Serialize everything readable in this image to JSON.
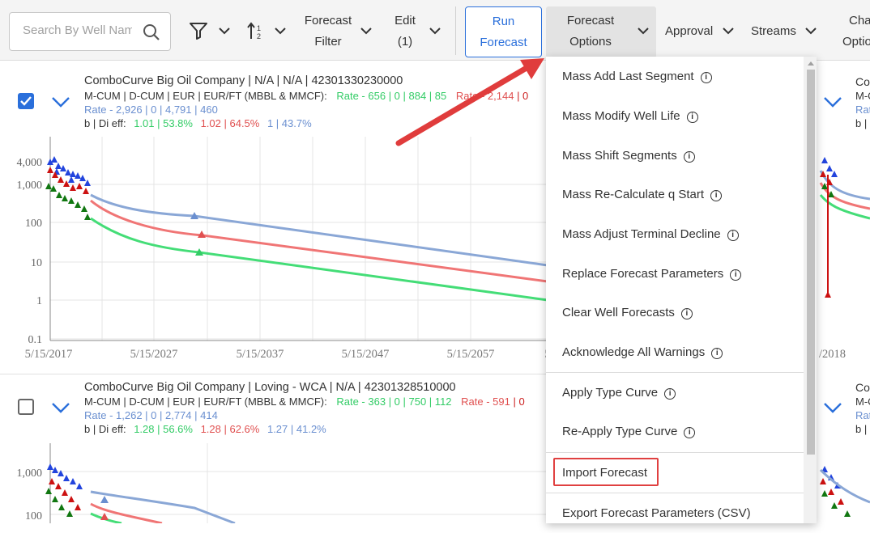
{
  "toolbar": {
    "search_placeholder": "Search By Well Name",
    "forecast_filter_line1": "Forecast",
    "forecast_filter_line2": "Filter",
    "edit_line1": "Edit",
    "edit_line2": "(1)",
    "run_line1": "Run",
    "run_line2": "Forecast",
    "options_line1": "Forecast",
    "options_line2": "Options",
    "approval": "Approval",
    "streams": "Streams",
    "chart_options_line1": "Cha",
    "chart_options_line2": "Optio"
  },
  "cards": [
    {
      "title": "ComboCurve Big Oil Company | N/A | N/A | 42301330230000",
      "line2_prefix": "M-CUM | D-CUM | EUR | EUR/FT (MBBL & MMCF):",
      "line2_rate_green": "Rate - 656",
      "line2_rest_green": "| 0 | 884 | 85",
      "line2_rate_red": "Rate - 2,144",
      "line2_rest_red": "| 0",
      "line3_blue": "Rate - 2,926 | 0 | 4,791 | 460",
      "line4_prefix": "b | Di eff:",
      "line4_green": "1.01 | 53.8%",
      "line4_red": "1.02 | 64.5%",
      "line4_blue": "1 | 43.7%",
      "checked": true,
      "y_ticks": [
        "4,000",
        "1,000",
        "100",
        "10",
        "1",
        "0.1"
      ],
      "x_ticks": [
        "5/15/2017",
        "5/15/2027",
        "5/15/2037",
        "5/15/2047",
        "5/15/2057",
        "5"
      ]
    },
    {
      "title": "ComboCurve Big Oil Company | Loving - WCA | N/A | 42301328510000",
      "line2_prefix": "M-CUM | D-CUM | EUR | EUR/FT (MBBL & MMCF):",
      "line2_rate_green": "Rate - 363",
      "line2_rest_green": "| 0 | 750 | 112",
      "line2_rate_red": "Rate - 591",
      "line2_rest_red": "| 0",
      "line3_blue": "Rate - 1,262 | 0 | 2,774 | 414",
      "line4_prefix": "b | Di eff:",
      "line4_green": "1.28 | 56.6%",
      "line4_red": "1.28 | 62.6%",
      "line4_blue": "1.27 | 41.2%",
      "checked": false,
      "y_ticks": [
        "1,000",
        "100"
      ]
    }
  ],
  "right_cards": [
    {
      "line1": "Co",
      "line2": "M-C",
      "line3": "Rat",
      "line4": "b |",
      "x_tick": "/2018"
    },
    {
      "line1": "Co",
      "line2": "M-C",
      "line3": "Rat",
      "line4": "b |"
    }
  ],
  "menu": {
    "items": [
      "Mass Add Last Segment",
      "Mass Modify Well Life",
      "Mass Shift Segments",
      "Mass Re-Calculate q Start",
      "Mass Adjust Terminal Decline",
      "Replace Forecast Parameters",
      "Clear Well Forecasts",
      "Acknowledge All Warnings",
      "Apply Type Curve",
      "Re-Apply Type Curve",
      "Import Forecast",
      "Export Forecast Parameters (CSV)"
    ],
    "info_glyph": "i"
  },
  "colors": {
    "accent": "#2a6fdb",
    "oil": "#33cc66",
    "gas": "#e05050",
    "water": "#6a8fd0",
    "highlight": "#e04040"
  }
}
